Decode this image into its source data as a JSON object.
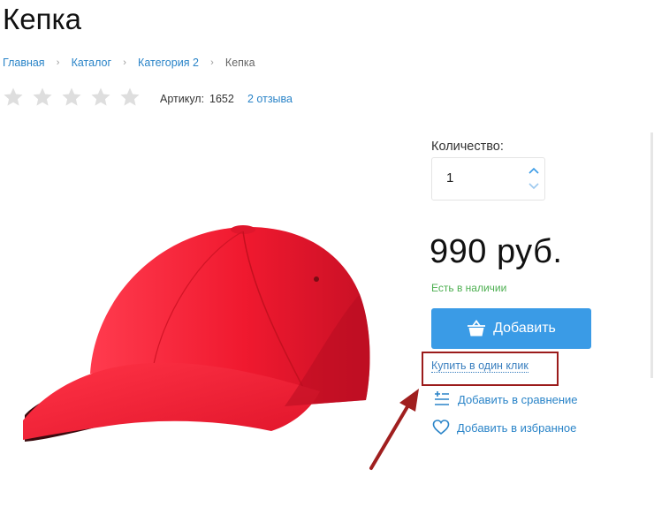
{
  "product": {
    "title": "Кепка",
    "sku_label": "Артикул:",
    "sku_value": "1652",
    "reviews_link": "2 отзыва",
    "rating": 0,
    "rating_max": 5,
    "image_icon": "red-baseball-cap"
  },
  "breadcrumb": {
    "items": [
      "Главная",
      "Каталог",
      "Категория 2",
      "Кепка"
    ],
    "separator_icon": "chevron-right-icon"
  },
  "purchase": {
    "quantity_label": "Количество:",
    "quantity_value": "1",
    "price": "990 руб.",
    "stock_status": "Есть в наличии",
    "add_button_label": "Добавить",
    "one_click_label": "Купить в один клик",
    "compare_label": "Добавить в сравнение",
    "favorite_label": "Добавить в избранное"
  },
  "colors": {
    "accent": "#3a9be6",
    "link": "#2a84c8",
    "stock": "#4caf50",
    "annotation": "#9b1b1b",
    "star_empty": "#dedede"
  }
}
